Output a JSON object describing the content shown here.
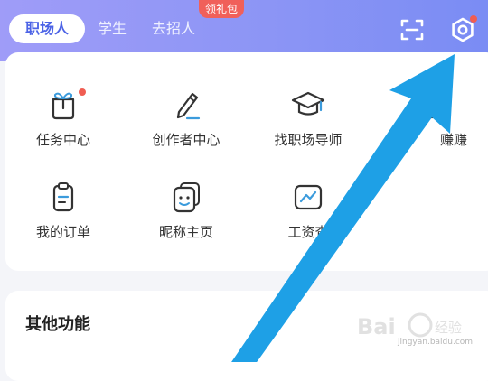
{
  "header": {
    "tabs": [
      {
        "label": "职场人"
      },
      {
        "label": "学生"
      },
      {
        "label": "去招人"
      }
    ],
    "badge": "领礼包",
    "icons": [
      "scan-icon",
      "settings-icon"
    ]
  },
  "services": [
    {
      "label": "任务中心",
      "icon": "gift-icon",
      "has_dot": true
    },
    {
      "label": "创作者中心",
      "icon": "pen-icon"
    },
    {
      "label": "找职场导师",
      "icon": "graduation-cap-icon"
    },
    {
      "label": "赚赚",
      "icon": "money-icon"
    },
    {
      "label": "我的订单",
      "icon": "clipboard-icon"
    },
    {
      "label": "昵称主页",
      "icon": "profile-card-icon"
    },
    {
      "label": "工资查",
      "icon": "salary-chart-icon"
    }
  ],
  "other": {
    "title": "其他功能"
  },
  "watermark": {
    "brand": "Bai",
    "cn": "经验",
    "url": "jingyan.baidu.com"
  },
  "colors": {
    "header_from": "#9f9cf8",
    "header_to": "#7a8cf4",
    "tab_active_text": "#4c63e6",
    "badge_bg": "#f0605a",
    "red_dot": "#f05d52",
    "arrow": "#1ea0e6"
  }
}
